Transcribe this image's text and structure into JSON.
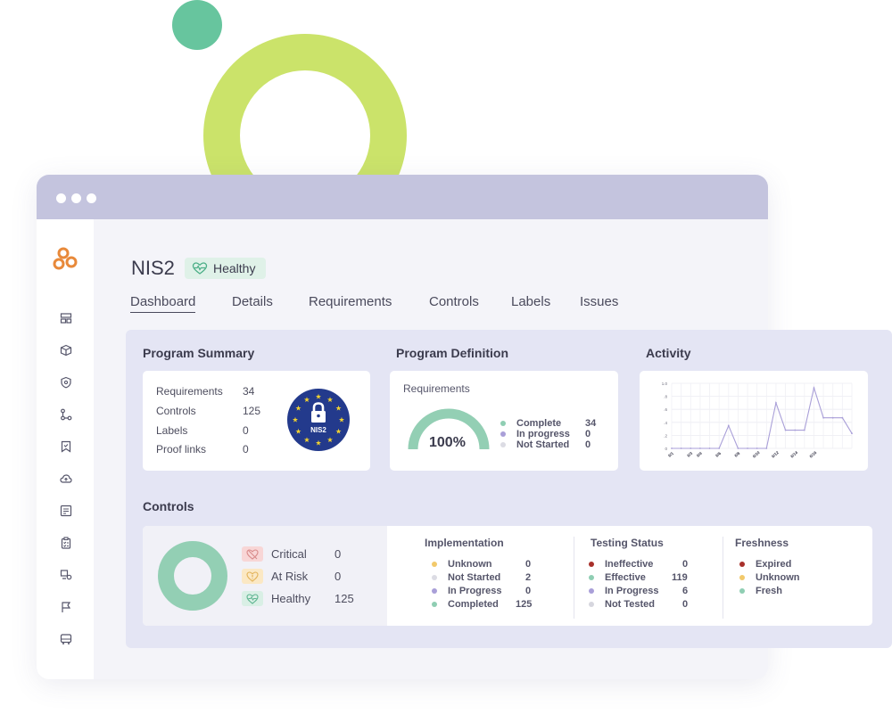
{
  "program": {
    "title": "NIS2",
    "health": "Healthy"
  },
  "tabs": [
    {
      "label": "Dashboard",
      "active": true
    },
    {
      "label": "Details"
    },
    {
      "label": "Requirements"
    },
    {
      "label": "Controls"
    },
    {
      "label": "Labels"
    },
    {
      "label": "Issues"
    }
  ],
  "sidebar": {
    "icons": [
      "dashboard-icon",
      "box-icon",
      "shield-icon",
      "flow-icon",
      "bookmark-icon",
      "cloud-icon",
      "report-icon",
      "clipboard-icon",
      "vendor-icon",
      "flag-icon",
      "bus-icon"
    ]
  },
  "summary": {
    "title": "Program Summary",
    "rows": [
      {
        "label": "Requirements",
        "value": "34"
      },
      {
        "label": "Controls",
        "value": "125"
      },
      {
        "label": "Labels",
        "value": "0"
      },
      {
        "label": "Proof links",
        "value": "0"
      }
    ],
    "badge_text": "NIS2"
  },
  "definition": {
    "title": "Program Definition",
    "card_title": "Requirements",
    "percent": "100%",
    "percent_value": 100,
    "legend": [
      {
        "label": "Complete",
        "value": "34",
        "color": "#8fceb3"
      },
      {
        "label": "In progress",
        "value": "0",
        "color": "#a99fd8"
      },
      {
        "label": "Not Started",
        "value": "0",
        "color": "#dcdce4"
      }
    ]
  },
  "activity": {
    "title": "Activity",
    "chart_data": {
      "type": "line",
      "x": [
        "6/1",
        "6/2",
        "6/3",
        "6/4",
        "6/5",
        "6/6",
        "6/7",
        "6/8",
        "6/9",
        "6/10",
        "6/11",
        "6/12",
        "6/13",
        "6/14",
        "6/15",
        "6/16",
        "6/17",
        "6/18",
        "6/19",
        "6/20"
      ],
      "x_tick_labels": [
        "6/1",
        "6/3",
        "6/4",
        "6/6",
        "6/8",
        "6/10",
        "6/12",
        "6/14",
        "6/16"
      ],
      "series": [
        {
          "values": [
            0,
            0,
            0,
            0,
            0,
            0,
            0.35,
            0,
            0,
            0,
            0,
            0.7,
            0.28,
            0.28,
            0.28,
            0.93,
            0.47,
            0.47,
            0.47,
            0.23
          ]
        }
      ],
      "y_ticks": [
        "0",
        ".2",
        ".4",
        ".6",
        ".8",
        "1.0"
      ],
      "ylim": [
        0,
        1.0
      ],
      "grid": true,
      "color": "#a99fd8"
    }
  },
  "controls": {
    "title": "Controls",
    "status": [
      {
        "label": "Critical",
        "value": "0",
        "chip_bg": "#f8d6d6",
        "chip_fg": "#d98b8b"
      },
      {
        "label": "At Risk",
        "value": "0",
        "chip_bg": "#fbe8c4",
        "chip_fg": "#e3b35a"
      },
      {
        "label": "Healthy",
        "value": "125",
        "chip_bg": "#d9efe5",
        "chip_fg": "#5fb591"
      }
    ],
    "donut_color": "#93cfb4",
    "implementation": {
      "title": "Implementation",
      "rows": [
        {
          "label": "Unknown",
          "value": "0",
          "color": "#f2c96b"
        },
        {
          "label": "Not Started",
          "value": "2",
          "color": "#dcdce4"
        },
        {
          "label": "In Progress",
          "value": "0",
          "color": "#a99fd8"
        },
        {
          "label": "Completed",
          "value": "125",
          "color": "#8fceb3"
        }
      ]
    },
    "testing": {
      "title": "Testing Status",
      "rows": [
        {
          "label": "Ineffective",
          "value": "0",
          "color": "#a8302b"
        },
        {
          "label": "Effective",
          "value": "119",
          "color": "#8fceb3"
        },
        {
          "label": "In Progress",
          "value": "6",
          "color": "#a99fd8"
        },
        {
          "label": "Not Tested",
          "value": "0",
          "color": "#d6d6de"
        }
      ]
    },
    "freshness": {
      "title": "Freshness",
      "rows": [
        {
          "label": "Expired",
          "color": "#a8302b"
        },
        {
          "label": "Unknown",
          "color": "#f2c96b"
        },
        {
          "label": "Fresh",
          "color": "#8fceb3"
        }
      ]
    }
  },
  "colors": {
    "accent": "#e8893a",
    "titlebar": "#c4c4de",
    "panel": "#e4e5f4",
    "healthy_badge": "#dff1e8"
  }
}
